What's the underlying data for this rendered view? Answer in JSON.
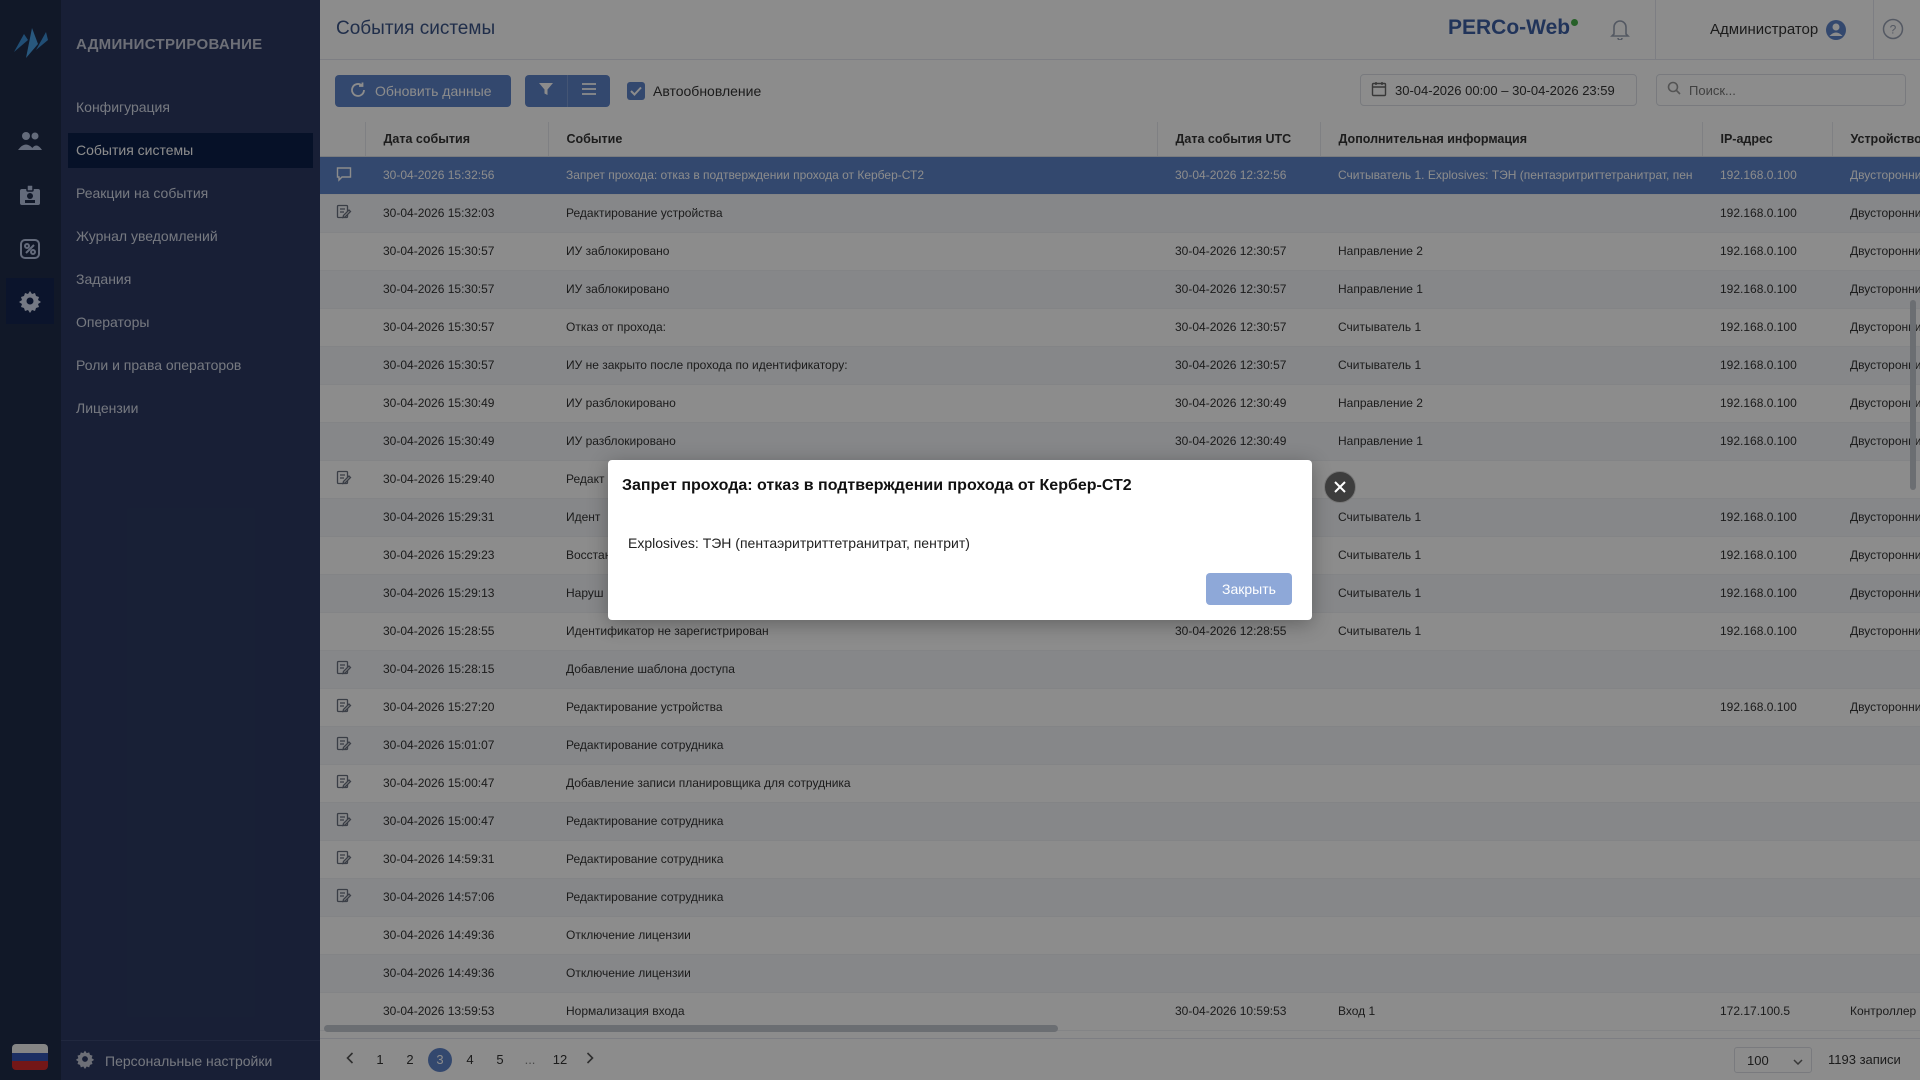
{
  "sidebar": {
    "title": "АДМИНИСТРИРОВАНИЕ",
    "items": [
      {
        "label": "Конфигурация"
      },
      {
        "label": "События системы"
      },
      {
        "label": "Реакции на события"
      },
      {
        "label": "Журнал уведомлений"
      },
      {
        "label": "Задания"
      },
      {
        "label": "Операторы"
      },
      {
        "label": "Роли и права операторов"
      },
      {
        "label": "Лицензии"
      }
    ],
    "footer_label": "Персональные настройки"
  },
  "header": {
    "page_title": "События системы",
    "brand": "PERCo-Web",
    "user_name": "Администратор"
  },
  "toolbar": {
    "refresh_label": "Обновить данные",
    "autoupdate_label": "Автообновление",
    "date_range": "30-04-2026 00:00 – 30-04-2026 23:59",
    "search_placeholder": "Поиск..."
  },
  "table": {
    "columns": [
      "Дата события",
      "Событие",
      "Дата события UTC",
      "Дополнительная информация",
      "IP-адрес",
      "Устройство"
    ],
    "rows": [
      {
        "icon": "comment",
        "date": "30-04-2026 15:32:56",
        "event": "Запрет прохода: отказ в подтверждении прохода от Кербер-СТ2",
        "utc": "30-04-2026 12:32:56",
        "info": "Считыватель 1. Explosives: ТЭН (пентаэритриттетранитрат, пен",
        "ip": "192.168.0.100",
        "device": "Двусторонний"
      },
      {
        "icon": "edit",
        "date": "30-04-2026 15:32:03",
        "event": "Редактирование устройства",
        "utc": "",
        "info": "",
        "ip": "192.168.0.100",
        "device": "Двусторонний"
      },
      {
        "icon": "",
        "date": "30-04-2026 15:30:57",
        "event": "ИУ заблокировано",
        "utc": "30-04-2026 12:30:57",
        "info": "Направление 2",
        "ip": "192.168.0.100",
        "device": "Двусторонний"
      },
      {
        "icon": "",
        "date": "30-04-2026 15:30:57",
        "event": "ИУ заблокировано",
        "utc": "30-04-2026 12:30:57",
        "info": "Направление 1",
        "ip": "192.168.0.100",
        "device": "Двусторонний"
      },
      {
        "icon": "",
        "date": "30-04-2026 15:30:57",
        "event": "Отказ от прохода:",
        "utc": "30-04-2026 12:30:57",
        "info": "Считыватель 1",
        "ip": "192.168.0.100",
        "device": "Двусторонний"
      },
      {
        "icon": "",
        "date": "30-04-2026 15:30:57",
        "event": "ИУ не закрыто после прохода по идентификатору:",
        "utc": "30-04-2026 12:30:57",
        "info": "Считыватель 1",
        "ip": "192.168.0.100",
        "device": "Двусторонний"
      },
      {
        "icon": "",
        "date": "30-04-2026 15:30:49",
        "event": "ИУ разблокировано",
        "utc": "30-04-2026 12:30:49",
        "info": "Направление 2",
        "ip": "192.168.0.100",
        "device": "Двусторонний"
      },
      {
        "icon": "",
        "date": "30-04-2026 15:30:49",
        "event": "ИУ разблокировано",
        "utc": "30-04-2026 12:30:49",
        "info": "Направление 1",
        "ip": "192.168.0.100",
        "device": "Двусторонний"
      },
      {
        "icon": "edit",
        "date": "30-04-2026 15:29:40",
        "event": "Редакт",
        "utc": "",
        "info": "",
        "ip": "",
        "device": ""
      },
      {
        "icon": "",
        "date": "30-04-2026 15:29:31",
        "event": "Идент",
        "utc": "",
        "info": "Считыватель 1",
        "ip": "192.168.0.100",
        "device": "Двусторонний"
      },
      {
        "icon": "",
        "date": "30-04-2026 15:29:23",
        "event": "Восстан",
        "utc": "",
        "info": "Считыватель 1",
        "ip": "192.168.0.100",
        "device": "Двусторонний"
      },
      {
        "icon": "",
        "date": "30-04-2026 15:29:13",
        "event": "Наруш",
        "utc": "",
        "info": "Считыватель 1",
        "ip": "192.168.0.100",
        "device": "Двусторонний"
      },
      {
        "icon": "",
        "date": "30-04-2026 15:28:55",
        "event": "Идентификатор не зарегистрирован",
        "utc": "30-04-2026 12:28:55",
        "info": "Считыватель 1",
        "ip": "192.168.0.100",
        "device": "Двусторонний"
      },
      {
        "icon": "edit",
        "date": "30-04-2026 15:28:15",
        "event": "Добавление шаблона доступа",
        "utc": "",
        "info": "",
        "ip": "",
        "device": ""
      },
      {
        "icon": "edit",
        "date": "30-04-2026 15:27:20",
        "event": "Редактирование устройства",
        "utc": "",
        "info": "",
        "ip": "192.168.0.100",
        "device": "Двусторонний"
      },
      {
        "icon": "edit",
        "date": "30-04-2026 15:01:07",
        "event": "Редактирование сотрудника",
        "utc": "",
        "info": "",
        "ip": "",
        "device": ""
      },
      {
        "icon": "edit",
        "date": "30-04-2026 15:00:47",
        "event": "Добавление записи планировщика для сотрудника",
        "utc": "",
        "info": "",
        "ip": "",
        "device": ""
      },
      {
        "icon": "edit",
        "date": "30-04-2026 15:00:47",
        "event": "Редактирование сотрудника",
        "utc": "",
        "info": "",
        "ip": "",
        "device": ""
      },
      {
        "icon": "edit",
        "date": "30-04-2026 14:59:31",
        "event": "Редактирование сотрудника",
        "utc": "",
        "info": "",
        "ip": "",
        "device": ""
      },
      {
        "icon": "edit",
        "date": "30-04-2026 14:57:06",
        "event": "Редактирование сотрудника",
        "utc": "",
        "info": "",
        "ip": "",
        "device": ""
      },
      {
        "icon": "",
        "date": "30-04-2026 14:49:36",
        "event": "Отключение лицензии",
        "utc": "",
        "info": "",
        "ip": "",
        "device": ""
      },
      {
        "icon": "",
        "date": "30-04-2026 14:49:36",
        "event": "Отключение лицензии",
        "utc": "",
        "info": "",
        "ip": "",
        "device": ""
      },
      {
        "icon": "",
        "date": "30-04-2026 13:59:53",
        "event": "Нормализация входа",
        "utc": "30-04-2026 10:59:53",
        "info": "Вход 1",
        "ip": "172.17.100.5",
        "device": "Контроллер"
      }
    ]
  },
  "pagination": {
    "pages": [
      "1",
      "2",
      "3",
      "4",
      "5",
      "...",
      "12"
    ],
    "current": "3",
    "per_page": "100",
    "total": "1193 записи"
  },
  "modal": {
    "title": "Запрет прохода: отказ в подтверждении прохода от Кербер-СТ2",
    "body": "Explosives: ТЭН (пентаэритриттетранитрат, пентрит)",
    "close_label": "Закрыть"
  },
  "colors": {
    "accent": "#5e83c8",
    "sidebar_bg": "#2c3a63",
    "rail_bg": "#1f2c4a",
    "brand_dot": "#48b04a"
  }
}
